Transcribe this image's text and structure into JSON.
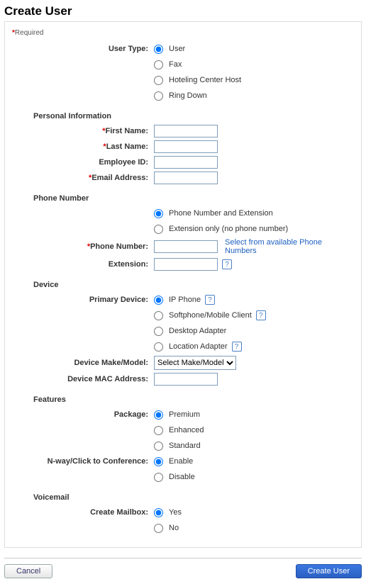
{
  "title": "Create User",
  "requiredNote": "Required",
  "labels": {
    "userType": "User Type:",
    "firstName": "First Name:",
    "lastName": "Last Name:",
    "employeeId": "Employee ID:",
    "email": "Email Address:",
    "phoneNumber": "Phone Number:",
    "extension": "Extension:",
    "primaryDevice": "Primary Device:",
    "deviceMakeModel": "Device Make/Model:",
    "deviceMac": "Device MAC Address:",
    "package": "Package:",
    "conference": "N-way/Click to Conference:",
    "createMailbox": "Create Mailbox:"
  },
  "sections": {
    "personal": "Personal Information",
    "phone": "Phone Number",
    "device": "Device",
    "features": "Features",
    "voicemail": "Voicemail"
  },
  "userType": {
    "options": [
      "User",
      "Fax",
      "Hoteling Center Host",
      "Ring Down"
    ],
    "selected": "User"
  },
  "personal": {
    "firstName": "",
    "lastName": "",
    "employeeId": "",
    "email": ""
  },
  "phone": {
    "mode": {
      "options": [
        "Phone Number and Extension",
        "Extension only (no phone number)"
      ],
      "selected": "Phone Number and Extension"
    },
    "number": "",
    "extension": "",
    "selectLink": "Select from available Phone Numbers"
  },
  "device": {
    "primary": {
      "options": [
        "IP Phone",
        "Softphone/Mobile Client",
        "Desktop Adapter",
        "Location Adapter"
      ],
      "selected": "IP Phone",
      "help": {
        "ipPhone": "?",
        "softphone": "?",
        "location": "?",
        "extension": "?"
      }
    },
    "makeModel": {
      "selected": "Select Make/Model"
    },
    "mac": ""
  },
  "features": {
    "package": {
      "options": [
        "Premium",
        "Enhanced",
        "Standard"
      ],
      "selected": "Premium"
    },
    "conference": {
      "options": [
        "Enable",
        "Disable"
      ],
      "selected": "Enable"
    }
  },
  "voicemail": {
    "createMailbox": {
      "options": [
        "Yes",
        "No"
      ],
      "selected": "Yes"
    }
  },
  "buttons": {
    "cancel": "Cancel",
    "create": "Create User"
  }
}
